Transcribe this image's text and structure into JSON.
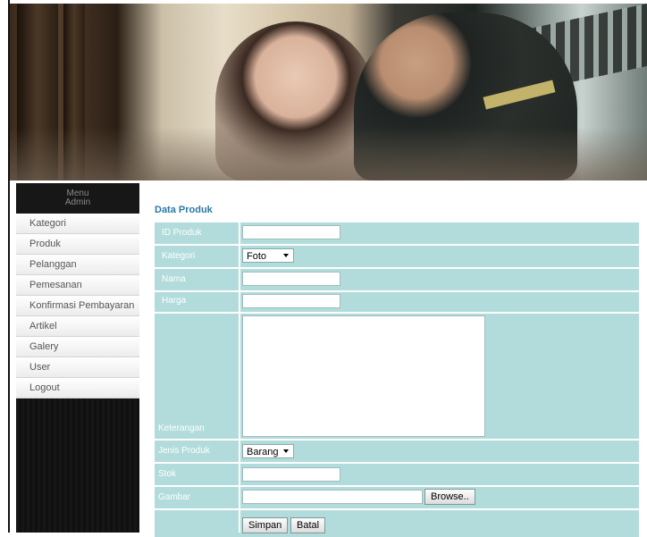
{
  "sidebar": {
    "header_line1": "Menu",
    "header_line2": "Admin",
    "items": [
      {
        "label": "Kategori"
      },
      {
        "label": "Produk"
      },
      {
        "label": "Pelanggan"
      },
      {
        "label": "Pemesanan"
      },
      {
        "label": "Konfirmasi Pembayaran"
      },
      {
        "label": "Artikel"
      },
      {
        "label": "Galery"
      },
      {
        "label": "User"
      },
      {
        "label": "Logout"
      }
    ]
  },
  "form": {
    "title": "Data Produk",
    "id_produk_label": "ID Produk",
    "id_produk_value": "",
    "kategori_label": "Kategori",
    "kategori_selected": "Foto",
    "nama_label": "Nama",
    "nama_value": "",
    "harga_label": "Harga",
    "harga_value": "",
    "keterangan_label": "Keterangan",
    "keterangan_value": "",
    "jenis_label": "Jenis Produk",
    "jenis_selected": "Barang",
    "stok_label": "Stok",
    "stok_value": "",
    "gambar_label": "Gambar",
    "browse_label": "Browse..",
    "simpan_label": "Simpan",
    "batal_label": "Batal"
  },
  "colors": {
    "form_bg": "#b2dcdb",
    "title": "#2a78a6",
    "sidebar_bg": "#161616"
  }
}
